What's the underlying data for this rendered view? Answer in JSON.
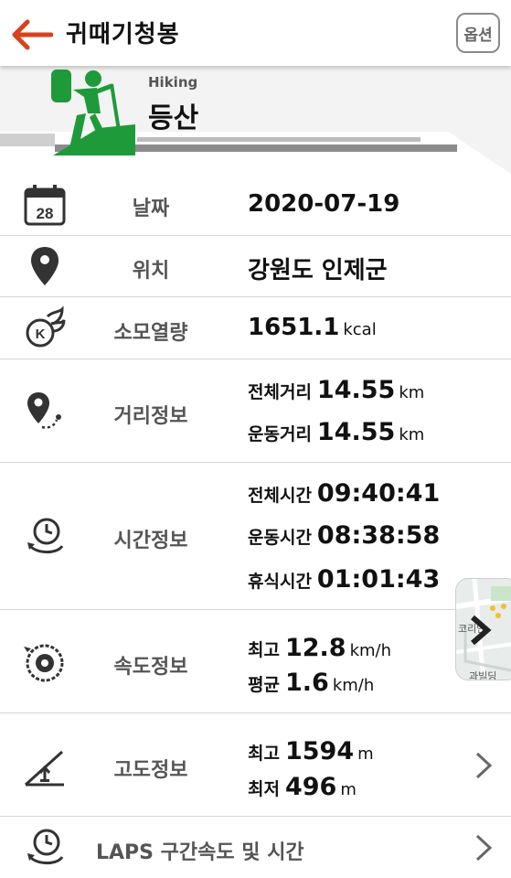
{
  "header": {
    "title": "귀때기청봉",
    "option_label": "옵션"
  },
  "activity": {
    "name_en": "Hiking",
    "name_ko": "등산"
  },
  "date": {
    "label": "날짜",
    "value": "2020-07-19",
    "icon_day": "28"
  },
  "location": {
    "label": "위치",
    "value": "강원도 인제군"
  },
  "calories": {
    "label": "소모열량",
    "value": "1651.1",
    "unit": "kcal"
  },
  "distance": {
    "label": "거리정보",
    "total_label": "전체거리",
    "total_value": "14.55",
    "move_label": "운동거리",
    "move_value": "14.55",
    "unit": "km"
  },
  "time": {
    "label": "시간정보",
    "total_label": "전체시간",
    "total_value": "09:40:41",
    "move_label": "운동시간",
    "move_value": "08:38:58",
    "rest_label": "휴식시간",
    "rest_value": "01:01:43"
  },
  "speed": {
    "label": "속도정보",
    "max_label": "최고",
    "max_value": "12.8",
    "avg_label": "평균",
    "avg_value": "1.6",
    "unit": "km/h"
  },
  "altitude": {
    "label": "고도정보",
    "max_label": "최고",
    "max_value": "1594",
    "min_label": "최저",
    "min_value": "496",
    "unit": "m"
  },
  "laps": {
    "label": "LAPS 구간속도 및 시간"
  },
  "map_preview": {
    "text_top": "코리안",
    "text_bottom": "과빌딩"
  },
  "colors": {
    "accent": "#d9411e",
    "green": "#1f9a3a",
    "gray_text": "#555555"
  }
}
